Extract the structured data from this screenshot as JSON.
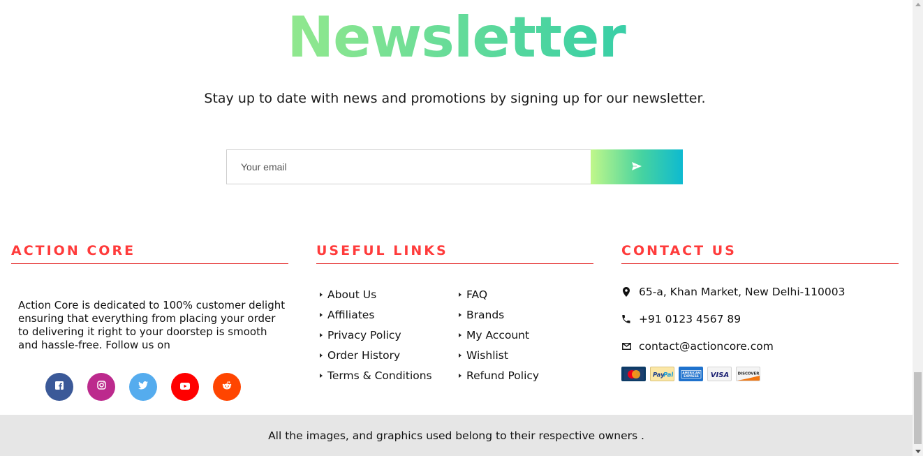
{
  "newsletter": {
    "title": "Newsletter",
    "subtitle": "Stay up to date with news and promotions by signing up for our newsletter.",
    "email_placeholder": "Your email",
    "email_value": "",
    "submit_icon": "send-icon"
  },
  "about": {
    "heading": "Action Core",
    "text": "Action Core is dedicated to 100% customer delight ensuring that everything from placing your order to delivering it right to your doorstep is smooth and hassle-free. Follow us on",
    "socials": [
      {
        "name": "facebook",
        "icon": "facebook-icon",
        "color": "#3b5998"
      },
      {
        "name": "instagram",
        "icon": "instagram-icon",
        "color": "#bc2a8d"
      },
      {
        "name": "twitter",
        "icon": "twitter-icon",
        "color": "#55acee"
      },
      {
        "name": "youtube",
        "icon": "youtube-icon",
        "color": "#ff0000"
      },
      {
        "name": "reddit",
        "icon": "reddit-icon",
        "color": "#ff4500"
      }
    ]
  },
  "useful_links": {
    "heading": "Useful Links",
    "left": [
      "About Us",
      "Affiliates",
      "Privacy Policy",
      "Order History",
      "Terms & Conditions"
    ],
    "right": [
      "FAQ",
      "Brands",
      "My Account",
      "Wishlist",
      "Refund Policy"
    ]
  },
  "contact": {
    "heading": "Contact Us",
    "address": "65-a, Khan Market, New Delhi-110003",
    "phone": "+91 0123 4567 89",
    "email": "contact@actioncore.com",
    "payment_cards": [
      "mastercard",
      "paypal",
      "american-express",
      "visa",
      "discover"
    ]
  },
  "footer": {
    "copyright": "All the images, and graphics used belong to their respective owners ."
  },
  "colors": {
    "accent_red": "#ff3b3b",
    "gradient_start": "#c0f78a",
    "gradient_end": "#0ebad0",
    "footer_bar": "#e6e6e6"
  }
}
